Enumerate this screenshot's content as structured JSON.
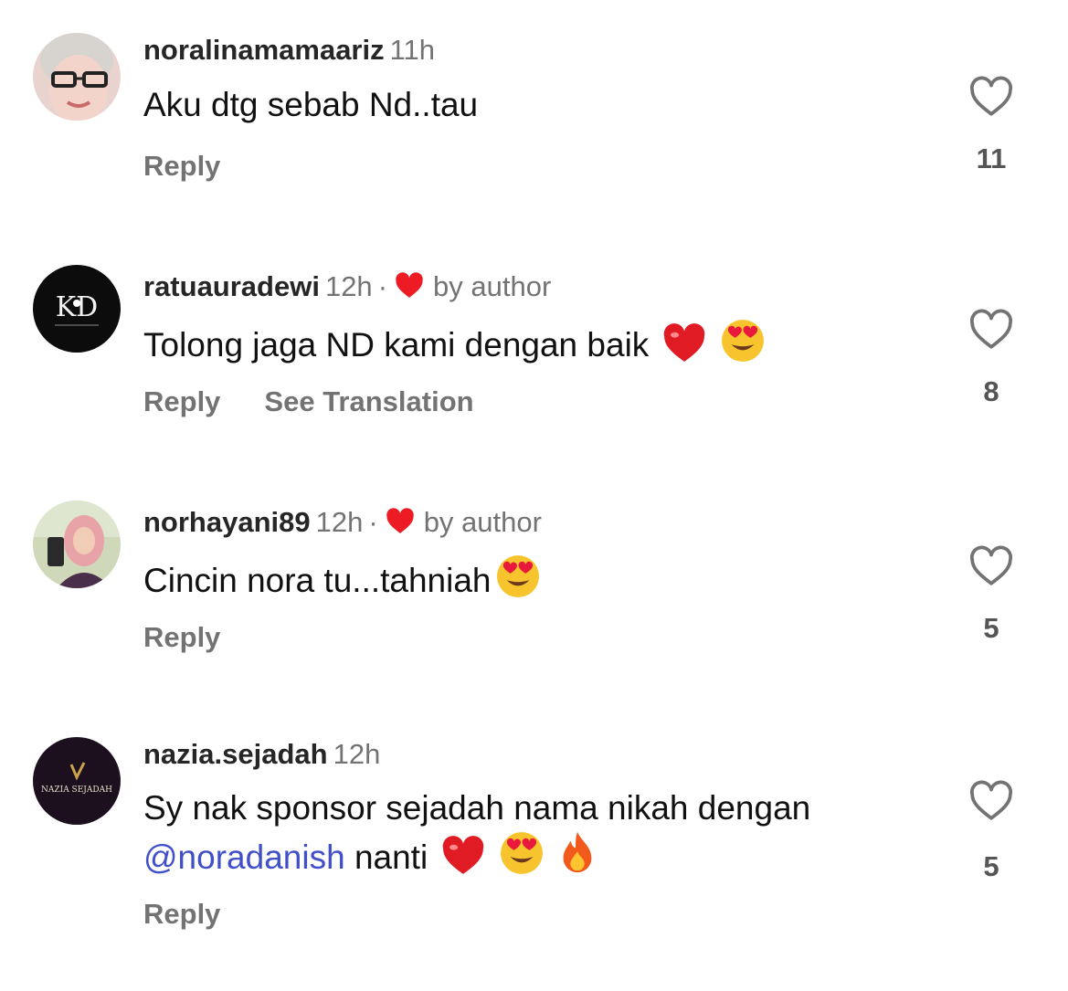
{
  "comments": [
    {
      "username": "noralinamamaariz",
      "time": "11h",
      "liked_by_author": false,
      "text": "Aku dtg sebab Nd..tau",
      "actions": {
        "reply": "Reply"
      },
      "like_count": "11",
      "avatar_icon": "portrait-photo"
    },
    {
      "username": "ratuauradewi",
      "time": "12h",
      "liked_by_author": true,
      "separator": "·",
      "by_author": "by author",
      "text": "Tolong jaga ND kami dengan baik",
      "emojis": [
        "red-heart-emoji",
        "heart-eyes-emoji"
      ],
      "actions": {
        "reply": "Reply",
        "translate": "See Translation"
      },
      "like_count": "8",
      "avatar_icon": "kd-logo",
      "avatar_text": "KD"
    },
    {
      "username": "norhayani89",
      "time": "12h",
      "liked_by_author": true,
      "separator": "·",
      "by_author": "by author",
      "text": "Cincin nora tu...tahniah",
      "emojis": [
        "heart-eyes-emoji"
      ],
      "actions": {
        "reply": "Reply"
      },
      "like_count": "5",
      "avatar_icon": "portrait-photo"
    },
    {
      "username": "nazia.sejadah",
      "time": "12h",
      "liked_by_author": false,
      "text_line1": "Sy nak sponsor sejadah nama nikah dengan",
      "mention": "@noradanish",
      "text_line2": "nanti",
      "emojis": [
        "red-heart-emoji",
        "heart-eyes-emoji",
        "fire-emoji"
      ],
      "actions": {
        "reply": "Reply"
      },
      "like_count": "5",
      "avatar_icon": "nazia-sejadah-logo",
      "avatar_text": "NAZIA SEJADAH"
    }
  ],
  "colors": {
    "username": "#262626",
    "secondary": "#737373",
    "mention": "#4150c8",
    "author_heart": "#ed1c24"
  }
}
